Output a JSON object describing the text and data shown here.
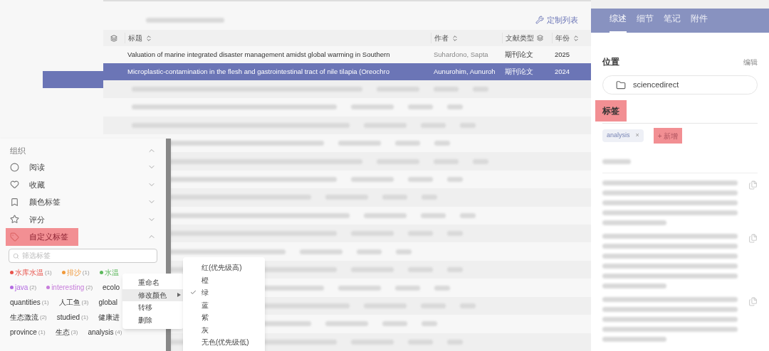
{
  "toolbar": {
    "customize": "定制列表"
  },
  "table": {
    "columns": [
      {
        "label": "标题",
        "sortable": true
      },
      {
        "label": "作者",
        "sortable": true
      },
      {
        "label": "文献类型",
        "sortable": false
      },
      {
        "label": "年份",
        "sortable": true
      }
    ],
    "rows": [
      {
        "title": "Valuation of marine integrated disaster management amidst global warming in Southern",
        "author": "Suhardono, Sapta",
        "type": "期刊论文",
        "year": "2025",
        "selected": false
      },
      {
        "title": "Microplastic-contamination in the flesh and gastrointestinal tract of nile tilapia (Oreochro",
        "author": "Aunurohim, Aunuroh",
        "type": "期刊论文",
        "year": "2024",
        "selected": true
      }
    ]
  },
  "sidebar": {
    "title": "组织",
    "expanded": true,
    "sections": [
      {
        "label": "阅读",
        "kind": "circle",
        "expanded": false,
        "selected": false
      },
      {
        "label": "收藏",
        "kind": "heart",
        "expanded": false,
        "selected": false
      },
      {
        "label": "颜色标签",
        "kind": "bookmark",
        "expanded": false,
        "selected": false
      },
      {
        "label": "评分",
        "kind": "star",
        "expanded": false,
        "selected": false
      },
      {
        "label": "自定义标签",
        "kind": "tag",
        "expanded": true,
        "selected": true
      }
    ],
    "filter": {
      "placeholder": "筛选标签"
    },
    "tag_rows": [
      [
        {
          "name": "水库水温",
          "count": "(1)",
          "color": "#e8534b"
        },
        {
          "name": "排沙",
          "count": "(1)",
          "color": "#f0993a"
        },
        {
          "name": "水温",
          "color": "#5cb85c"
        }
      ],
      [
        {
          "name": "java",
          "count": "(2)",
          "color": "#b36ae2"
        },
        {
          "name": "interesting",
          "count": "(2)",
          "color": "#c77ddb"
        },
        {
          "name": "ecolo"
        }
      ],
      [
        {
          "name": "quantities",
          "count": "(1)"
        },
        {
          "name": "人工鱼",
          "count": "(3)"
        },
        {
          "name": "global"
        }
      ],
      [
        {
          "name": "生态激流",
          "count": "(2)"
        },
        {
          "name": "studied",
          "count": "(1)"
        },
        {
          "name": "健康进"
        }
      ],
      [
        {
          "name": "province",
          "count": "(1)"
        },
        {
          "name": "生态",
          "count": "(3)"
        },
        {
          "name": "analysis",
          "count": "(4)"
        }
      ]
    ]
  },
  "context_menu": [
    {
      "label": "重命名",
      "kind": "item",
      "selected": false
    },
    {
      "label": "修改颜色",
      "kind": "submenu",
      "selected": true
    },
    {
      "label": "转移",
      "kind": "item",
      "selected": false
    },
    {
      "label": "删除",
      "kind": "item",
      "selected": false
    }
  ],
  "color_menu": [
    {
      "label": "红(优先级高)",
      "checked": false
    },
    {
      "label": "橙",
      "checked": false
    },
    {
      "label": "绿",
      "checked": true
    },
    {
      "label": "蓝",
      "checked": false
    },
    {
      "label": "紫",
      "checked": false
    },
    {
      "label": "灰",
      "checked": false
    },
    {
      "label": "无色(优先级低)",
      "checked": false
    }
  ],
  "details": {
    "tabs": [
      {
        "label": "综述",
        "selected": true
      },
      {
        "label": "细节",
        "selected": false
      },
      {
        "label": "笔记",
        "selected": false
      },
      {
        "label": "附件",
        "selected": false
      }
    ],
    "location_label": "位置",
    "edit": "编辑",
    "folder": "sciencedirect",
    "tags_label": {
      "text": "标签",
      "highlighted": true
    },
    "tags": [
      {
        "name": "analysis",
        "remove": "×"
      }
    ],
    "add_tag": {
      "label": "+ 新增",
      "highlighted": true
    }
  }
}
